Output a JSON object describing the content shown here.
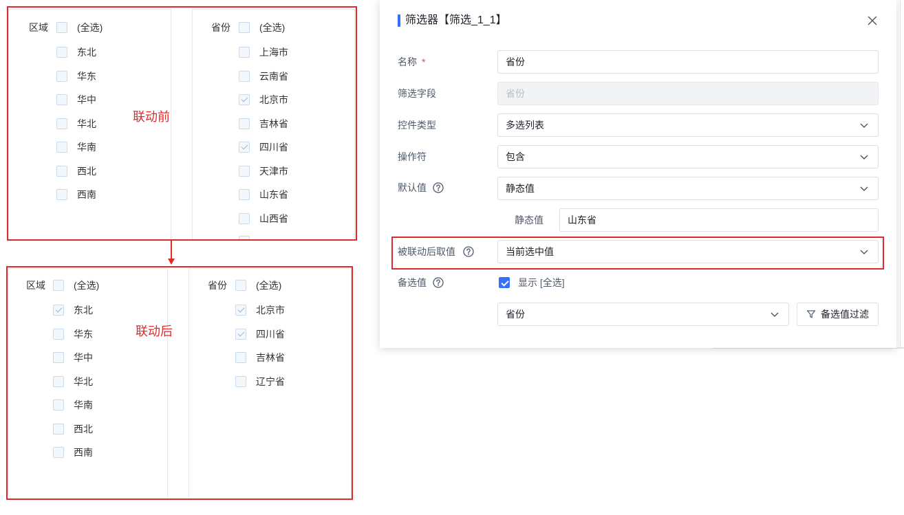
{
  "before": {
    "annotation": "联动前",
    "region": {
      "label": "区域",
      "select_all": {
        "label": "(全选)",
        "checked": false
      },
      "items": [
        {
          "label": "东北",
          "checked": false
        },
        {
          "label": "华东",
          "checked": false
        },
        {
          "label": "华中",
          "checked": false
        },
        {
          "label": "华北",
          "checked": false
        },
        {
          "label": "华南",
          "checked": false
        },
        {
          "label": "西北",
          "checked": false
        },
        {
          "label": "西南",
          "checked": false
        }
      ]
    },
    "province": {
      "label": "省份",
      "select_all": {
        "label": "(全选)",
        "checked": false
      },
      "items": [
        {
          "label": "上海市",
          "checked": false
        },
        {
          "label": "云南省",
          "checked": false
        },
        {
          "label": "北京市",
          "checked": true
        },
        {
          "label": "吉林省",
          "checked": false
        },
        {
          "label": "四川省",
          "checked": true
        },
        {
          "label": "天津市",
          "checked": false
        },
        {
          "label": "山东省",
          "checked": false
        },
        {
          "label": "山西省",
          "checked": false
        }
      ]
    }
  },
  "after": {
    "annotation": "联动后",
    "region": {
      "label": "区域",
      "select_all": {
        "label": "(全选)",
        "checked": false
      },
      "items": [
        {
          "label": "东北",
          "checked": true
        },
        {
          "label": "华东",
          "checked": false
        },
        {
          "label": "华中",
          "checked": false
        },
        {
          "label": "华北",
          "checked": false
        },
        {
          "label": "华南",
          "checked": false
        },
        {
          "label": "西北",
          "checked": false
        },
        {
          "label": "西南",
          "checked": false
        }
      ]
    },
    "province": {
      "label": "省份",
      "select_all": {
        "label": "(全选)",
        "checked": false
      },
      "items": [
        {
          "label": "北京市",
          "checked": true
        },
        {
          "label": "四川省",
          "checked": true
        },
        {
          "label": "吉林省",
          "checked": false
        },
        {
          "label": "辽宁省",
          "checked": false
        }
      ]
    }
  },
  "dialog": {
    "title": "筛选器【筛选_1_1】",
    "name": {
      "label": "名称",
      "required_mark": "*",
      "value": "省份"
    },
    "filter_field": {
      "label": "筛选字段",
      "value": "省份"
    },
    "control_type": {
      "label": "控件类型",
      "value": "多选列表"
    },
    "operator": {
      "label": "操作符",
      "value": "包含"
    },
    "default_value": {
      "label": "默认值",
      "value": "静态值"
    },
    "static_value": {
      "label": "静态值",
      "value": "山东省"
    },
    "linked_value": {
      "label": "被联动后取值",
      "value": "当前选中值"
    },
    "options": {
      "label": "备选值",
      "show_select_all": {
        "label": "显示 [全选]",
        "checked": true
      },
      "source": "省份",
      "filter_button": "备选值过滤"
    }
  },
  "icons": {
    "close": "close-icon",
    "help": "help-icon",
    "dropdown": "chevron-down-icon",
    "filter": "funnel-icon",
    "arrow": "arrow-down-icon"
  },
  "colors": {
    "accent": "#3370ff",
    "annotation_red": "#e02a2a",
    "required": "#f53f3f"
  }
}
